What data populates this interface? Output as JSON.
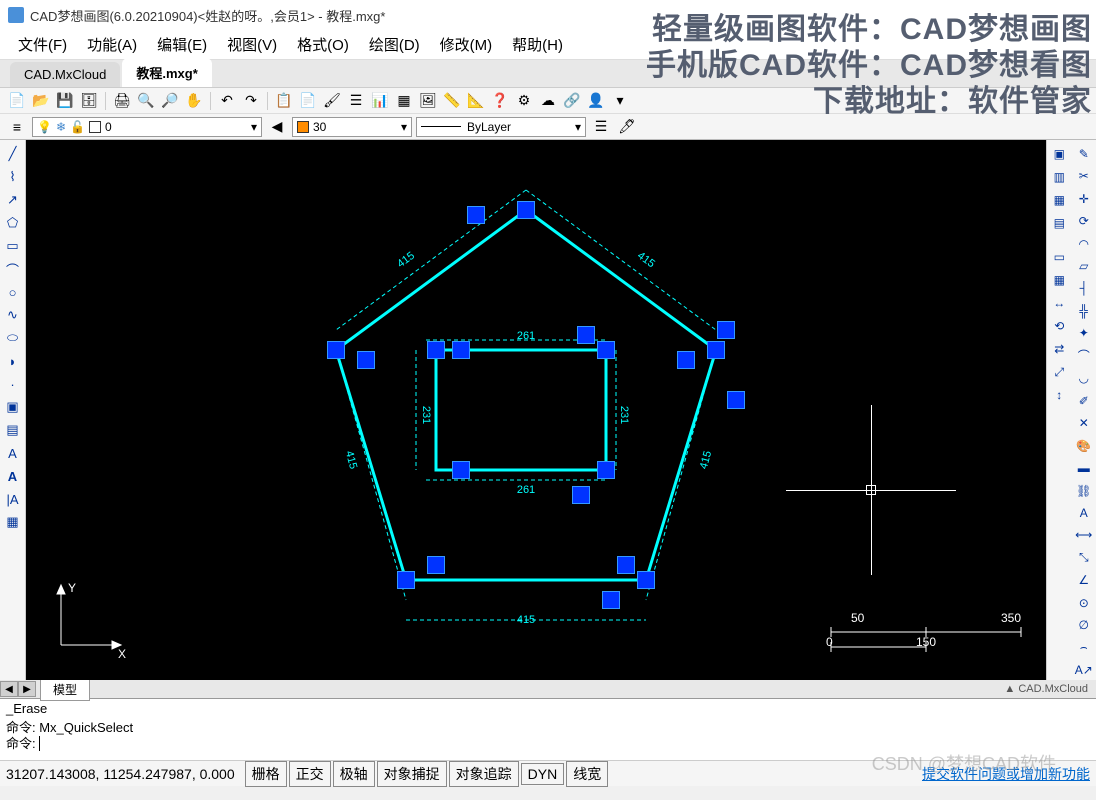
{
  "title": "CAD梦想画图(6.0.20210904)<姓赵的呀。,会员1> - 教程.mxg*",
  "menu": [
    "文件(F)",
    "功能(A)",
    "编辑(E)",
    "视图(V)",
    "格式(O)",
    "绘图(D)",
    "修改(M)",
    "帮助(H)"
  ],
  "tabs": {
    "inactive": "CAD.MxCloud",
    "active": "教程.mxg*"
  },
  "layer": {
    "name": "0",
    "color": "30",
    "linetype": "ByLayer"
  },
  "model_tab": "模型",
  "cmd": {
    "line1": "_Erase",
    "line2": "命令: Mx_QuickSelect",
    "prompt": "命令: "
  },
  "status": {
    "coords": "31207.143008,  11254.247987,  0.000",
    "toggles": [
      "栅格",
      "正交",
      "极轴",
      "对象捕捉",
      "对象追踪",
      "DYN",
      "线宽"
    ],
    "feedback": "提交软件问题或增加新功能"
  },
  "overlay": {
    "l1": "轻量级画图软件：CAD梦想画图",
    "l2": "手机版CAD软件：CAD梦想看图",
    "l3": "下载地址：软件管家"
  },
  "scale": {
    "t1": "50",
    "t2": "350",
    "b1": "0",
    "b2": "150"
  },
  "dims": {
    "d1": "415",
    "d2": "261",
    "d3": "231",
    "d4": "415",
    "d5": "415",
    "d6": "261",
    "d7": "231",
    "d8": "415"
  },
  "watermark": "CSDN @梦想CAD软件",
  "right_label": "CAD.MxCloud"
}
